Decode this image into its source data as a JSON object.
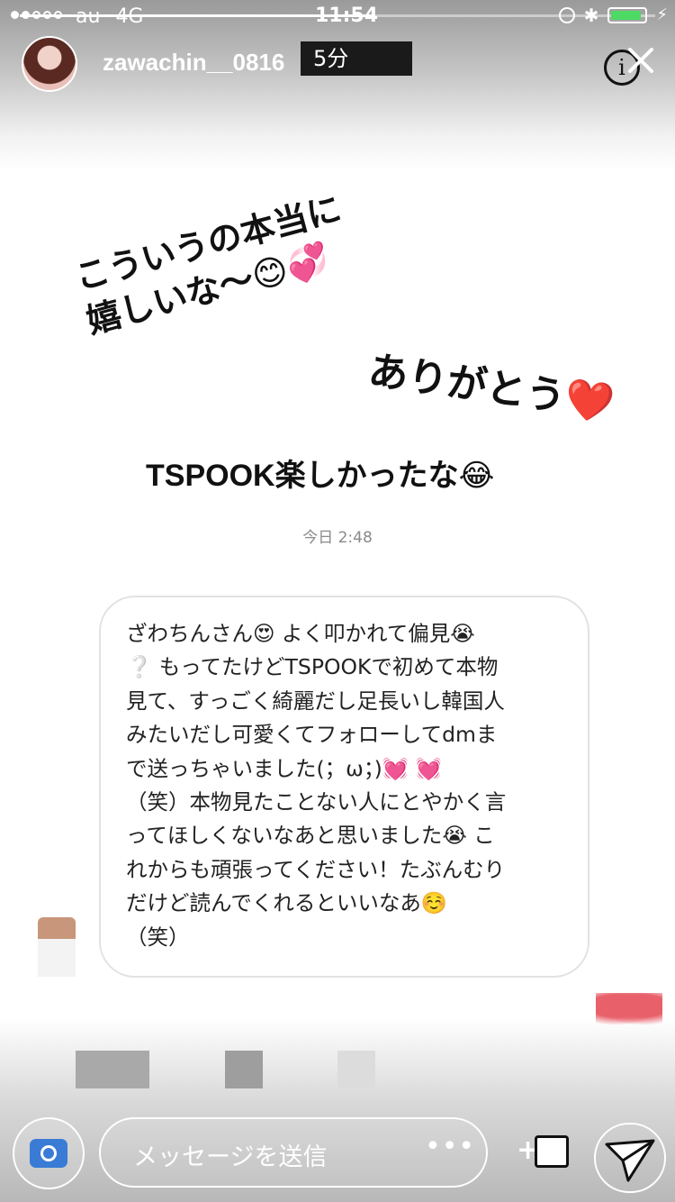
{
  "status_bar": {
    "carrier": "au",
    "network": "4G",
    "time": "11:54",
    "battery_level": 0.9,
    "story_progress": 0.56
  },
  "story_header": {
    "username": "zawachin__0816",
    "time_ago": "5分",
    "info_icon": "info-icon",
    "close_icon": "close-icon"
  },
  "story_text": {
    "line1": "こういうの本当に",
    "line2": "嬉しいな〜😊💞",
    "thanks": "ありがとう❤️",
    "tspook": "TSPOOK楽しかったな😂"
  },
  "dm": {
    "timestamp": "今日 2:48",
    "message_lines": [
      "ざわちんさん😍 よく叩かれて偏見😭",
      "❔ もってたけどTSPOOKで初めて本物",
      "見て、すっごく綺麗だし足長いし韓国人",
      "みたいだし可愛くてフォローしてdmま",
      "で送っちゃいました(；ω；)💓 💓",
      "（笑）本物見たことない人にとやかく言",
      "ってほしくないなあと思いました😭 こ",
      "れからも頑張ってください！たぶんむり",
      "だけど読んでくれるといいなあ☺️",
      "（笑）"
    ]
  },
  "reply_bar": {
    "placeholder": "メッセージを送信",
    "more": "•••",
    "plus": "+"
  },
  "colors": {
    "bubble_border": "#e2e2e2",
    "heart_red": "#e0211f",
    "battery_green": "#4cd964"
  }
}
